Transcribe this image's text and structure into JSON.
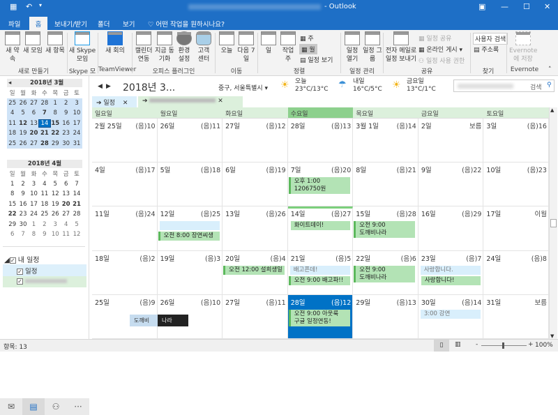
{
  "window": {
    "title": "- Outlook"
  },
  "menu_tabs": [
    "파일",
    "홈",
    "보내기/받기",
    "폴더",
    "보기"
  ],
  "tell_me": "어떤 작업을 원하시나요?",
  "ribbon": {
    "new_appointment": "새 약속",
    "new_meeting": "새 모임",
    "new_items": "새 항목",
    "group_new": "새로 만들기",
    "skype_meeting": "새 Skype 모임",
    "group_skype": "Skype 모임",
    "tv_meeting": "새 회의",
    "group_tv": "TeamViewer",
    "cal_link": "캘린더 연동",
    "sync_now": "지금 동기화",
    "settings": "환경 설정",
    "support": "고객 센터",
    "group_plugin": "오피스 플러그인",
    "today": "오늘",
    "next7": "다음 7일",
    "group_goto": "이동",
    "day": "일",
    "workweek": "작업 주",
    "week": "주",
    "month": "월",
    "schedule_view": "일정 보기",
    "group_arrange": "정렬",
    "open_cal": "일정 열기",
    "cal_groups": "일정 그룹",
    "group_manage": "일정 관리",
    "email_cal": "전자 메일로 일정 보내기",
    "share_cal": "일정 공유",
    "publish_online": "온라인 게시",
    "cal_perm": "일정 사용 권한",
    "group_share": "공유",
    "search_people": "사용자 검색",
    "address_book": "주소록",
    "group_find": "찾기",
    "evernote_save": "Evernote에 저장",
    "group_evernote": "Evernote"
  },
  "mini_calendars": [
    {
      "title": "2018년 3월",
      "weekdays": [
        "일",
        "월",
        "화",
        "수",
        "목",
        "금",
        "토"
      ],
      "weeks": [
        [
          "25",
          "26",
          "27",
          "28",
          "1",
          "2",
          "3"
        ],
        [
          "4",
          "5",
          "6",
          "7",
          "8",
          "9",
          "10"
        ],
        [
          "11",
          "12",
          "13",
          "14",
          "15",
          "16",
          "17"
        ],
        [
          "18",
          "19",
          "20",
          "21",
          "22",
          "23",
          "24"
        ],
        [
          "25",
          "26",
          "27",
          "28",
          "29",
          "30",
          "31"
        ]
      ]
    },
    {
      "title": "2018년 4월",
      "weekdays": [
        "일",
        "월",
        "화",
        "수",
        "목",
        "금",
        "토"
      ],
      "weeks": [
        [
          "1",
          "2",
          "3",
          "4",
          "5",
          "6",
          "7"
        ],
        [
          "8",
          "9",
          "10",
          "11",
          "12",
          "13",
          "14"
        ],
        [
          "15",
          "16",
          "17",
          "18",
          "19",
          "20",
          "21"
        ],
        [
          "22",
          "23",
          "24",
          "25",
          "26",
          "27",
          "28"
        ],
        [
          "29",
          "30",
          "1",
          "2",
          "3",
          "4",
          "5"
        ],
        [
          "6",
          "7",
          "8",
          "9",
          "10",
          "11",
          "12"
        ]
      ]
    }
  ],
  "my_calendars": {
    "header": "내 일정",
    "items": [
      "일정"
    ]
  },
  "status": {
    "items": "항목: 13",
    "zoom": "100%"
  },
  "cal_header": {
    "title": "2018년 3...",
    "location": "중구, 서울특별시",
    "weather": [
      {
        "label": "오늘",
        "temp": "23°C/13°C",
        "icon": "sun-cloud"
      },
      {
        "label": "내일",
        "temp": "16°C/5°C",
        "icon": "rain"
      },
      {
        "label": "금요일",
        "temp": "13°C/1°C",
        "icon": "sun"
      }
    ],
    "search": "검색"
  },
  "cal_tabs": [
    "일정"
  ],
  "weekdays": [
    "일요일",
    "월요일",
    "화요일",
    "수요일",
    "목요일",
    "금요일",
    "토요일"
  ],
  "weeks": [
    [
      {
        "d": "2월 25일",
        "l": "(음)10"
      },
      {
        "d": "26일",
        "l": "(음)11"
      },
      {
        "d": "27일",
        "l": "(음)12"
      },
      {
        "d": "28일",
        "l": "(음)13"
      },
      {
        "d": "3월 1일",
        "l": "(음)14"
      },
      {
        "d": "2일",
        "l": "보름"
      },
      {
        "d": "3일",
        "l": "(음)16"
      }
    ],
    [
      {
        "d": "4일",
        "l": "(음)17"
      },
      {
        "d": "5일",
        "l": "(음)18"
      },
      {
        "d": "6일",
        "l": "(음)19"
      },
      {
        "d": "7일",
        "l": "(음)20",
        "ev": [
          {
            "t": "오후 1:00\n1206750원"
          }
        ]
      },
      {
        "d": "8일",
        "l": "(음)21"
      },
      {
        "d": "9일",
        "l": "(음)22"
      },
      {
        "d": "10일",
        "l": "(음)23"
      }
    ],
    [
      {
        "d": "11일",
        "l": "(음)24"
      },
      {
        "d": "12일",
        "l": "(음)25",
        "ev": [
          {
            "t": " ",
            "c": "blue"
          },
          {
            "t": "오전 8:00 장연씨생"
          }
        ]
      },
      {
        "d": "13일",
        "l": "(음)26"
      },
      {
        "d": "14일",
        "l": "(음)27",
        "ev": [
          {
            "t": "화이트데이!",
            "c": "hol"
          }
        ]
      },
      {
        "d": "15일",
        "l": "(음)28",
        "ev": [
          {
            "t": "오전 9:00\n도깨비나라"
          }
        ]
      },
      {
        "d": "16일",
        "l": "(음)29"
      },
      {
        "d": "17일",
        "l": "이월"
      }
    ],
    [
      {
        "d": "18일",
        "l": "(음)2"
      },
      {
        "d": "19일",
        "l": "(음)3"
      },
      {
        "d": "20일",
        "l": "(음)4",
        "ev": [
          {
            "t": "오전 12:00 설희생일"
          }
        ]
      },
      {
        "d": "21일",
        "l": "(음)5",
        "ev": [
          {
            "t": "배고픈데!",
            "c": "blue"
          },
          {
            "t": "오전 9:00 배고파!!"
          }
        ]
      },
      {
        "d": "22일",
        "l": "(음)6",
        "ev": [
          {
            "t": "오전 9:00\n도깨비나라"
          }
        ]
      },
      {
        "d": "23일",
        "l": "(음)7",
        "ev": [
          {
            "t": "사랑합니다.",
            "c": "blue"
          },
          {
            "t": "사랑합니다!",
            "c": "hol"
          }
        ]
      },
      {
        "d": "24일",
        "l": "(음)8"
      }
    ],
    [
      {
        "d": "25일",
        "l": "(음)9"
      },
      {
        "d": "26일",
        "l": "(음)10"
      },
      {
        "d": "27일",
        "l": "(음)11"
      },
      {
        "d": "28일",
        "l": "(음)12",
        "ev": [
          {
            "t": "오전 9:00 아웃룩\n구글 일정연동!"
          }
        ]
      },
      {
        "d": "29일",
        "l": "(음)13"
      },
      {
        "d": "30일",
        "l": "(음)14",
        "ev": [
          {
            "t": "3:00 강연",
            "c": "blue"
          }
        ]
      },
      {
        "d": "31일",
        "l": "보름"
      }
    ]
  ],
  "overlay_image": {
    "left": "도깨비",
    "right": "나라"
  },
  "colors": {
    "brand": "#1e6fc6",
    "event_green": "#b3e3b5",
    "selected": "#0072c6"
  }
}
